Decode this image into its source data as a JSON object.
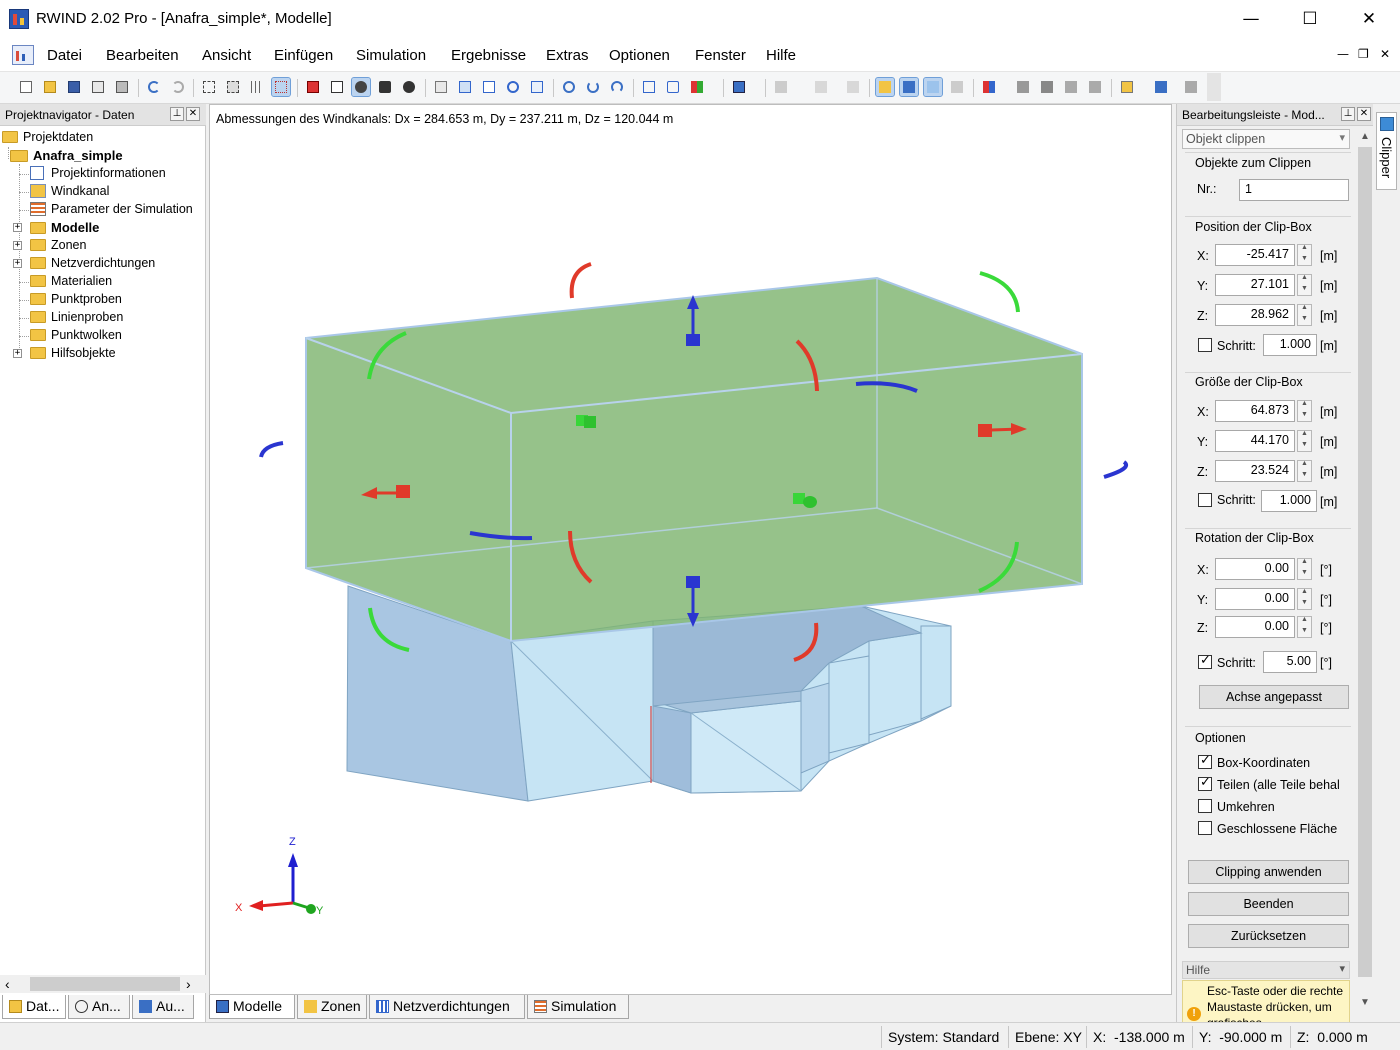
{
  "window": {
    "title": "RWIND 2.02 Pro - [Anafra_simple*, Modelle]",
    "min": "—",
    "max": "☐",
    "close": "✕"
  },
  "menu": {
    "items": [
      "Datei",
      "Bearbeiten",
      "Ansicht",
      "Einfügen",
      "Simulation",
      "Ergebnisse",
      "Extras",
      "Optionen",
      "Fenster",
      "Hilfe"
    ],
    "mdi": {
      "min": "—",
      "restore": "❐",
      "close": "✕"
    }
  },
  "navigator": {
    "title": "Projektnavigator - Daten",
    "root": "Projektdaten",
    "project": "Anafra_simple",
    "items": [
      {
        "label": "Projektinformationen",
        "icon": "document-icon"
      },
      {
        "label": "Windkanal",
        "icon": "wind-tunnel-icon"
      },
      {
        "label": "Parameter der Simulation",
        "icon": "parameters-icon"
      },
      {
        "label": "Modelle",
        "icon": "folder-icon",
        "bold": true,
        "expandable": true
      },
      {
        "label": "Zonen",
        "icon": "folder-icon",
        "expandable": true
      },
      {
        "label": "Netzverdichtungen",
        "icon": "folder-icon",
        "expandable": true
      },
      {
        "label": "Materialien",
        "icon": "folder-icon"
      },
      {
        "label": "Punktproben",
        "icon": "folder-icon"
      },
      {
        "label": "Linienproben",
        "icon": "folder-icon"
      },
      {
        "label": "Punktwolken",
        "icon": "folder-icon"
      },
      {
        "label": "Hilfsobjekte",
        "icon": "folder-icon",
        "expandable": true
      }
    ],
    "tabs": [
      "Dat...",
      "An...",
      "Au..."
    ]
  },
  "viewport": {
    "caption": "Abmessungen des Windkanals: Dx = 284.653 m, Dy = 237.211 m, Dz = 120.044 m",
    "axes": {
      "x": "X",
      "y": "Y",
      "z": "Z"
    },
    "colors": {
      "clipbox": "#7fb570",
      "building": "#b7d9ef",
      "axis_x": "#e02020",
      "axis_y": "#1fa51f",
      "axis_z": "#1f1fd0"
    }
  },
  "view_tabs": [
    "Modelle",
    "Zonen",
    "Netzverdichtungen",
    "Simulation"
  ],
  "panel": {
    "title": "Bearbeitungsleiste - Mod...",
    "combo": "Objekt clippen",
    "objects_group": "Objekte zum Clippen",
    "nr_label": "Nr.:",
    "nr_value": "1",
    "position_group": "Position der Clip-Box",
    "position": {
      "x": "-25.417",
      "y": "27.101",
      "z": "28.962"
    },
    "size_group": "Größe der Clip-Box",
    "size": {
      "x": "64.873",
      "y": "44.170",
      "z": "23.524"
    },
    "rotation_group": "Rotation der Clip-Box",
    "rotation": {
      "x": "0.00",
      "y": "0.00",
      "z": "0.00"
    },
    "step_label": "Schritt:",
    "step_position": "1.000",
    "step_size": "1.000",
    "step_rotation": "5.00",
    "unit_m": "[m]",
    "unit_deg": "[°]",
    "label_x": "X:",
    "label_y": "Y:",
    "label_z": "Z:",
    "fit_axis": "Achse angepasst",
    "options_group": "Optionen",
    "options": [
      {
        "label": "Box-Koordinaten",
        "checked": true
      },
      {
        "label": "Teilen (alle Teile behal",
        "checked": true
      },
      {
        "label": "Umkehren",
        "checked": false
      },
      {
        "label": "Geschlossene Fläche",
        "checked": false
      }
    ],
    "apply": "Clipping anwenden",
    "finish": "Beenden",
    "reset": "Zurücksetzen",
    "help_title": "Hilfe",
    "help_text": "Esc-Taste oder die rechte Maustaste drücken, um grafisches"
  },
  "sidetab": "Clipper",
  "status": {
    "system": "System: Standard",
    "plane": "Ebene: XY",
    "x": "X:  -138.000 m",
    "y": "Y:  -90.000 m",
    "z": "Z:  0.000 m"
  }
}
